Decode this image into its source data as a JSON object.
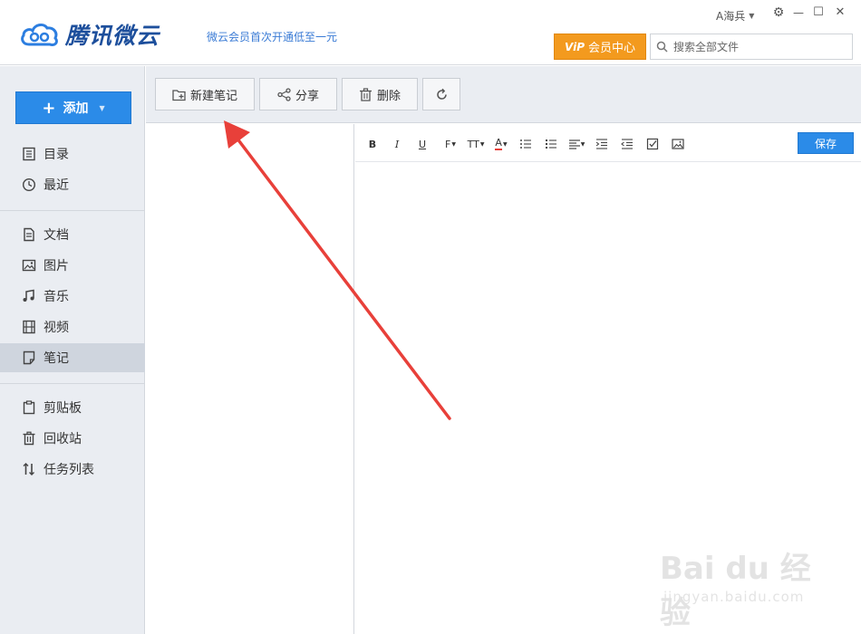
{
  "app": {
    "logo_text": "腾讯微云",
    "promo": "微云会员首次开通低至一元",
    "user": "A海兵",
    "vip_prefix": "ViP",
    "vip_label": "会员中心",
    "search_placeholder": "搜索全部文件"
  },
  "window_controls": {
    "settings": "⚙",
    "minimize": "—",
    "maximize": "☐",
    "close": "✕"
  },
  "sidebar": {
    "add_label": "添加",
    "groups": [
      [
        {
          "label": "目录",
          "icon": "catalog-icon"
        },
        {
          "label": "最近",
          "icon": "clock-icon"
        }
      ],
      [
        {
          "label": "文档",
          "icon": "document-icon"
        },
        {
          "label": "图片",
          "icon": "image-icon"
        },
        {
          "label": "音乐",
          "icon": "music-icon"
        },
        {
          "label": "视频",
          "icon": "video-icon"
        },
        {
          "label": "笔记",
          "icon": "note-icon",
          "active": true
        }
      ],
      [
        {
          "label": "剪贴板",
          "icon": "clipboard-icon"
        },
        {
          "label": "回收站",
          "icon": "trash-icon"
        },
        {
          "label": "任务列表",
          "icon": "transfer-icon"
        }
      ]
    ]
  },
  "toolbar": {
    "new_note": "新建笔记",
    "share": "分享",
    "delete": "删除"
  },
  "editor": {
    "format_buttons": [
      "B",
      "I",
      "U",
      "F",
      "TT",
      "A"
    ],
    "save": "保存"
  },
  "colors": {
    "accent": "#2b8be8",
    "vip": "#f39a1e",
    "sidebar_bg": "#eaedf2",
    "arrow": "#e8403a"
  },
  "watermark": {
    "brand": "Bai du 经验",
    "url": "jingyan.baidu.com"
  }
}
